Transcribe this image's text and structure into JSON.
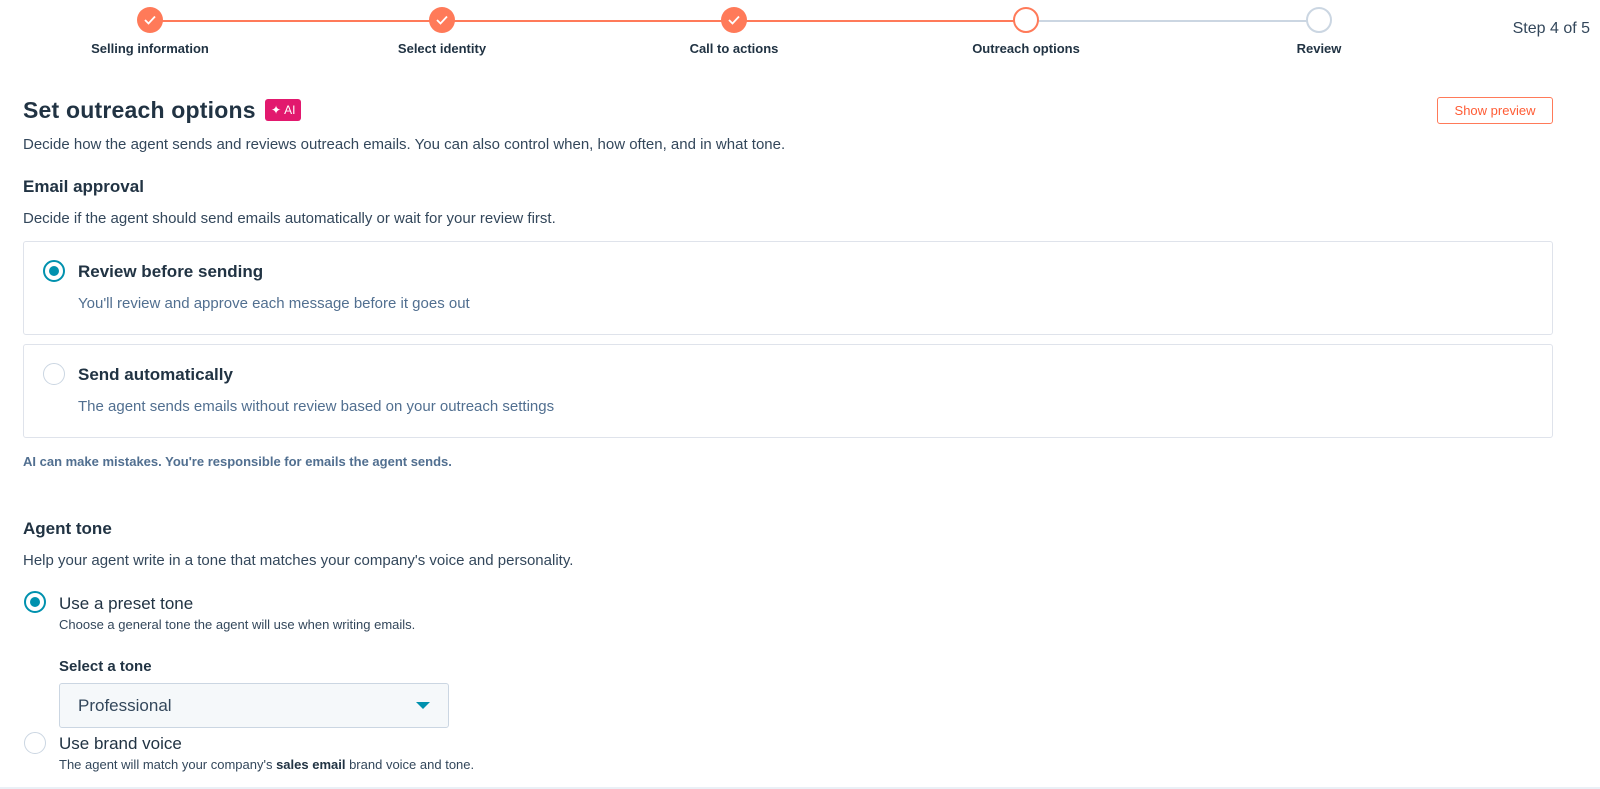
{
  "stepper": {
    "steps": [
      {
        "label": "Selling information",
        "state": "done"
      },
      {
        "label": "Select identity",
        "state": "done"
      },
      {
        "label": "Call to actions",
        "state": "done"
      },
      {
        "label": "Outreach options",
        "state": "current"
      },
      {
        "label": "Review",
        "state": "todo"
      }
    ],
    "counter": "Step 4 of 5",
    "accent_color": "#ff7a59",
    "inactive_color": "#cbd6e2"
  },
  "header": {
    "title": "Set outreach options",
    "ai_badge": "AI",
    "ai_badge_icon": "sparkle-icon",
    "show_preview_label": "Show preview",
    "subtitle": "Decide how the agent sends and reviews outreach emails. You can also control when, how often, and in what tone."
  },
  "email_approval": {
    "title": "Email approval",
    "description": "Decide if the agent should send emails automatically or wait for your review first.",
    "options": [
      {
        "title": "Review before sending",
        "description": "You'll review and approve each message before it goes out",
        "selected": true
      },
      {
        "title": "Send automatically",
        "description": "The agent sends emails without review based on your outreach settings",
        "selected": false
      }
    ],
    "disclaimer": "AI can make mistakes. You're responsible for emails the agent sends."
  },
  "agent_tone": {
    "title": "Agent tone",
    "description": "Help your agent write in a tone that matches your company's voice and personality.",
    "preset": {
      "label": "Use a preset tone",
      "help": "Choose a general tone the agent will use when writing emails.",
      "selected": true,
      "select_label": "Select a tone",
      "select_value": "Professional"
    },
    "brand_voice": {
      "label": "Use brand voice",
      "help_prefix": "The agent will match your company's ",
      "help_bold": "sales email",
      "help_suffix": " brand voice and tone.",
      "selected": false
    }
  },
  "colors": {
    "radio_selected": "#0091ae",
    "ai_badge": "#e2196e",
    "heading": "#213343"
  }
}
